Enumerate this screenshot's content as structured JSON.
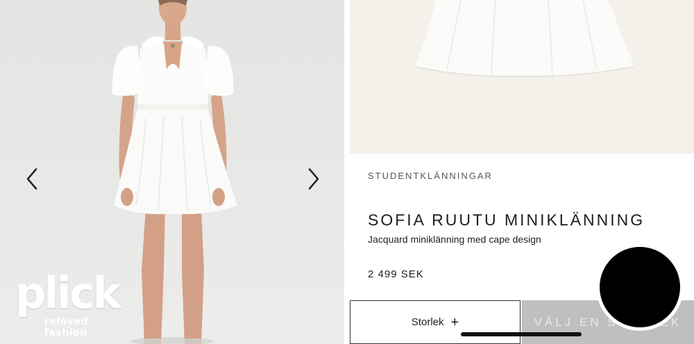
{
  "gallery": {
    "prev_icon": "chevron-left-icon",
    "next_icon": "chevron-right-icon"
  },
  "watermark": {
    "logo_text": "plick",
    "tagline": "reloved fashion"
  },
  "product": {
    "category": "STUDENTKLÄNNINGAR",
    "title": "SOFIA RUUTU MINIKLÄNNING",
    "description": "Jacquard miniklänning med cape design",
    "price": "2 499 SEK"
  },
  "actions": {
    "size_label": "Storlek",
    "size_icon": "+",
    "choose_label": "VÄLJ EN STORLEK"
  },
  "colors": {
    "dress": "#fbfbf9",
    "skin": "#d7a488",
    "button_disabled": "#bfbfbf"
  }
}
